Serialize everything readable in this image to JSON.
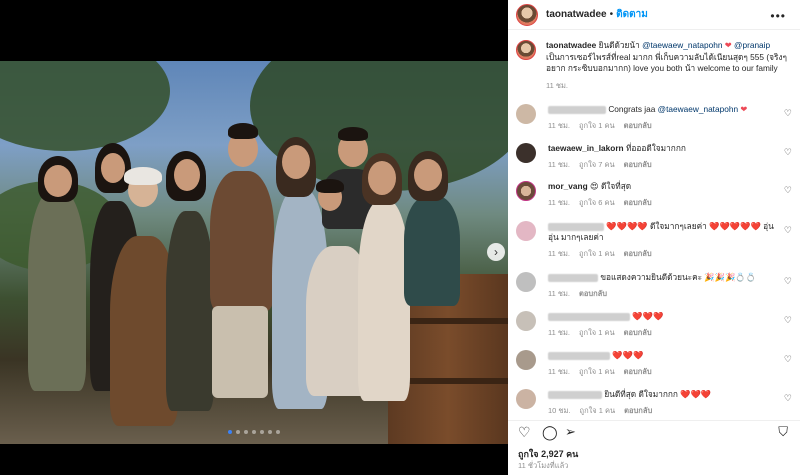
{
  "header": {
    "username": "taonatwadee",
    "separator": "•",
    "follow_label": "ติดตาม",
    "more_label": "•••"
  },
  "caption": {
    "username": "taonatwadee",
    "text_1": "ยินดีด้วยน้า",
    "mention_1": "@taewaew_natapohn",
    "heart": "❤",
    "mention_2": "@pranaip",
    "text_2": "เป็นการเซอร์ไพรส์ที่real มากก พี่เก็บความลับได้เนียนสุดๆ 555 (จริงๆอยาก กระซิบบอกมากก) love you both น้า welcome to our family",
    "time": "11 ชม."
  },
  "comments": [
    {
      "username": "",
      "text": "Congrats jaa",
      "mention": "@taewaew_natapohn",
      "emoji": "❤",
      "time": "11 ชม.",
      "likes": "ถูกใจ 1 คน",
      "reply": "ตอบกลับ"
    },
    {
      "username": "taewaew_in_lakorn",
      "text": "ที่อออดีใจมากกก",
      "mention": "",
      "emoji": "",
      "time": "11 ชม.",
      "likes": "ถูกใจ 7 คน",
      "reply": "ตอบกลับ"
    },
    {
      "username": "mor_vang",
      "text": "ดีใจที่สุด",
      "mention": "",
      "emoji": "😍",
      "time": "11 ชม.",
      "likes": "ถูกใจ 6 คน",
      "reply": "ตอบกลับ"
    },
    {
      "username": "",
      "text": "❤️❤️❤️❤️ ดีใจมากๆเลยค่า ❤️❤️❤️❤️❤️ อุ่นอุ่น มากๆเลยค่า",
      "mention": "",
      "emoji": "",
      "time": "11 ชม.",
      "likes": "ถูกใจ 1 คน",
      "reply": "ตอบกลับ"
    },
    {
      "username": "",
      "text": "ขอแสดงความยินดีด้วยนะคะ 🎉🎉🎉💍💍",
      "mention": "",
      "emoji": "",
      "time": "11 ชม.",
      "likes": "",
      "reply": "ตอบกลับ"
    },
    {
      "username": "",
      "text": "❤️❤️❤️",
      "mention": "",
      "emoji": "",
      "time": "11 ชม.",
      "likes": "ถูกใจ 1 คน",
      "reply": "ตอบกลับ"
    },
    {
      "username": "",
      "text": "❤️❤️❤️",
      "mention": "",
      "emoji": "",
      "time": "11 ชม.",
      "likes": "ถูกใจ 1 คน",
      "reply": "ตอบกลับ"
    },
    {
      "username": "",
      "text": "ยินดีที่สุด ดีใจมากกก ❤️❤️❤️",
      "mention": "",
      "emoji": "",
      "time": "10 ชม.",
      "likes": "ถูกใจ 1 คน",
      "reply": "ตอบกลับ"
    }
  ],
  "actions": {
    "like_icon": "heart-outline-icon",
    "comment_icon": "comment-icon",
    "share_icon": "paper-plane-icon",
    "save_icon": "bookmark-icon"
  },
  "likes_text": "ถูกใจ 2,927 คน",
  "posted_ago": "11 ชั่วโมงที่แล้ว",
  "carousel": {
    "next_arrow": "›",
    "dot_count": 7,
    "active_dot": 1
  },
  "colors": {
    "accent": "#0095f6",
    "heart": "#ed4956",
    "muted": "#8e8e8e",
    "mention": "#00376b"
  }
}
